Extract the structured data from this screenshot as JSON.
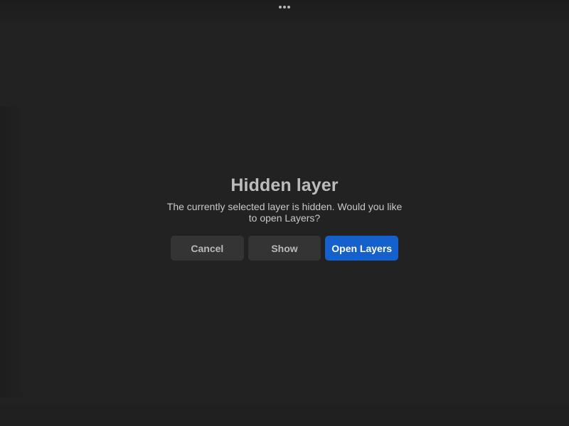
{
  "dialog": {
    "title": "Hidden layer",
    "message": "The currently selected layer is hidden. Would you like to open Layers?",
    "buttons": {
      "cancel": "Cancel",
      "show": "Show",
      "open_layers": "Open Layers"
    }
  },
  "top_bar": {
    "handle_icon": "more-dots-icon"
  },
  "colors": {
    "background": "#222222",
    "secondary_button": "#343434",
    "primary_button": "#1460cc",
    "title_text": "#bcbcbc",
    "message_text": "#c9c9c9"
  }
}
